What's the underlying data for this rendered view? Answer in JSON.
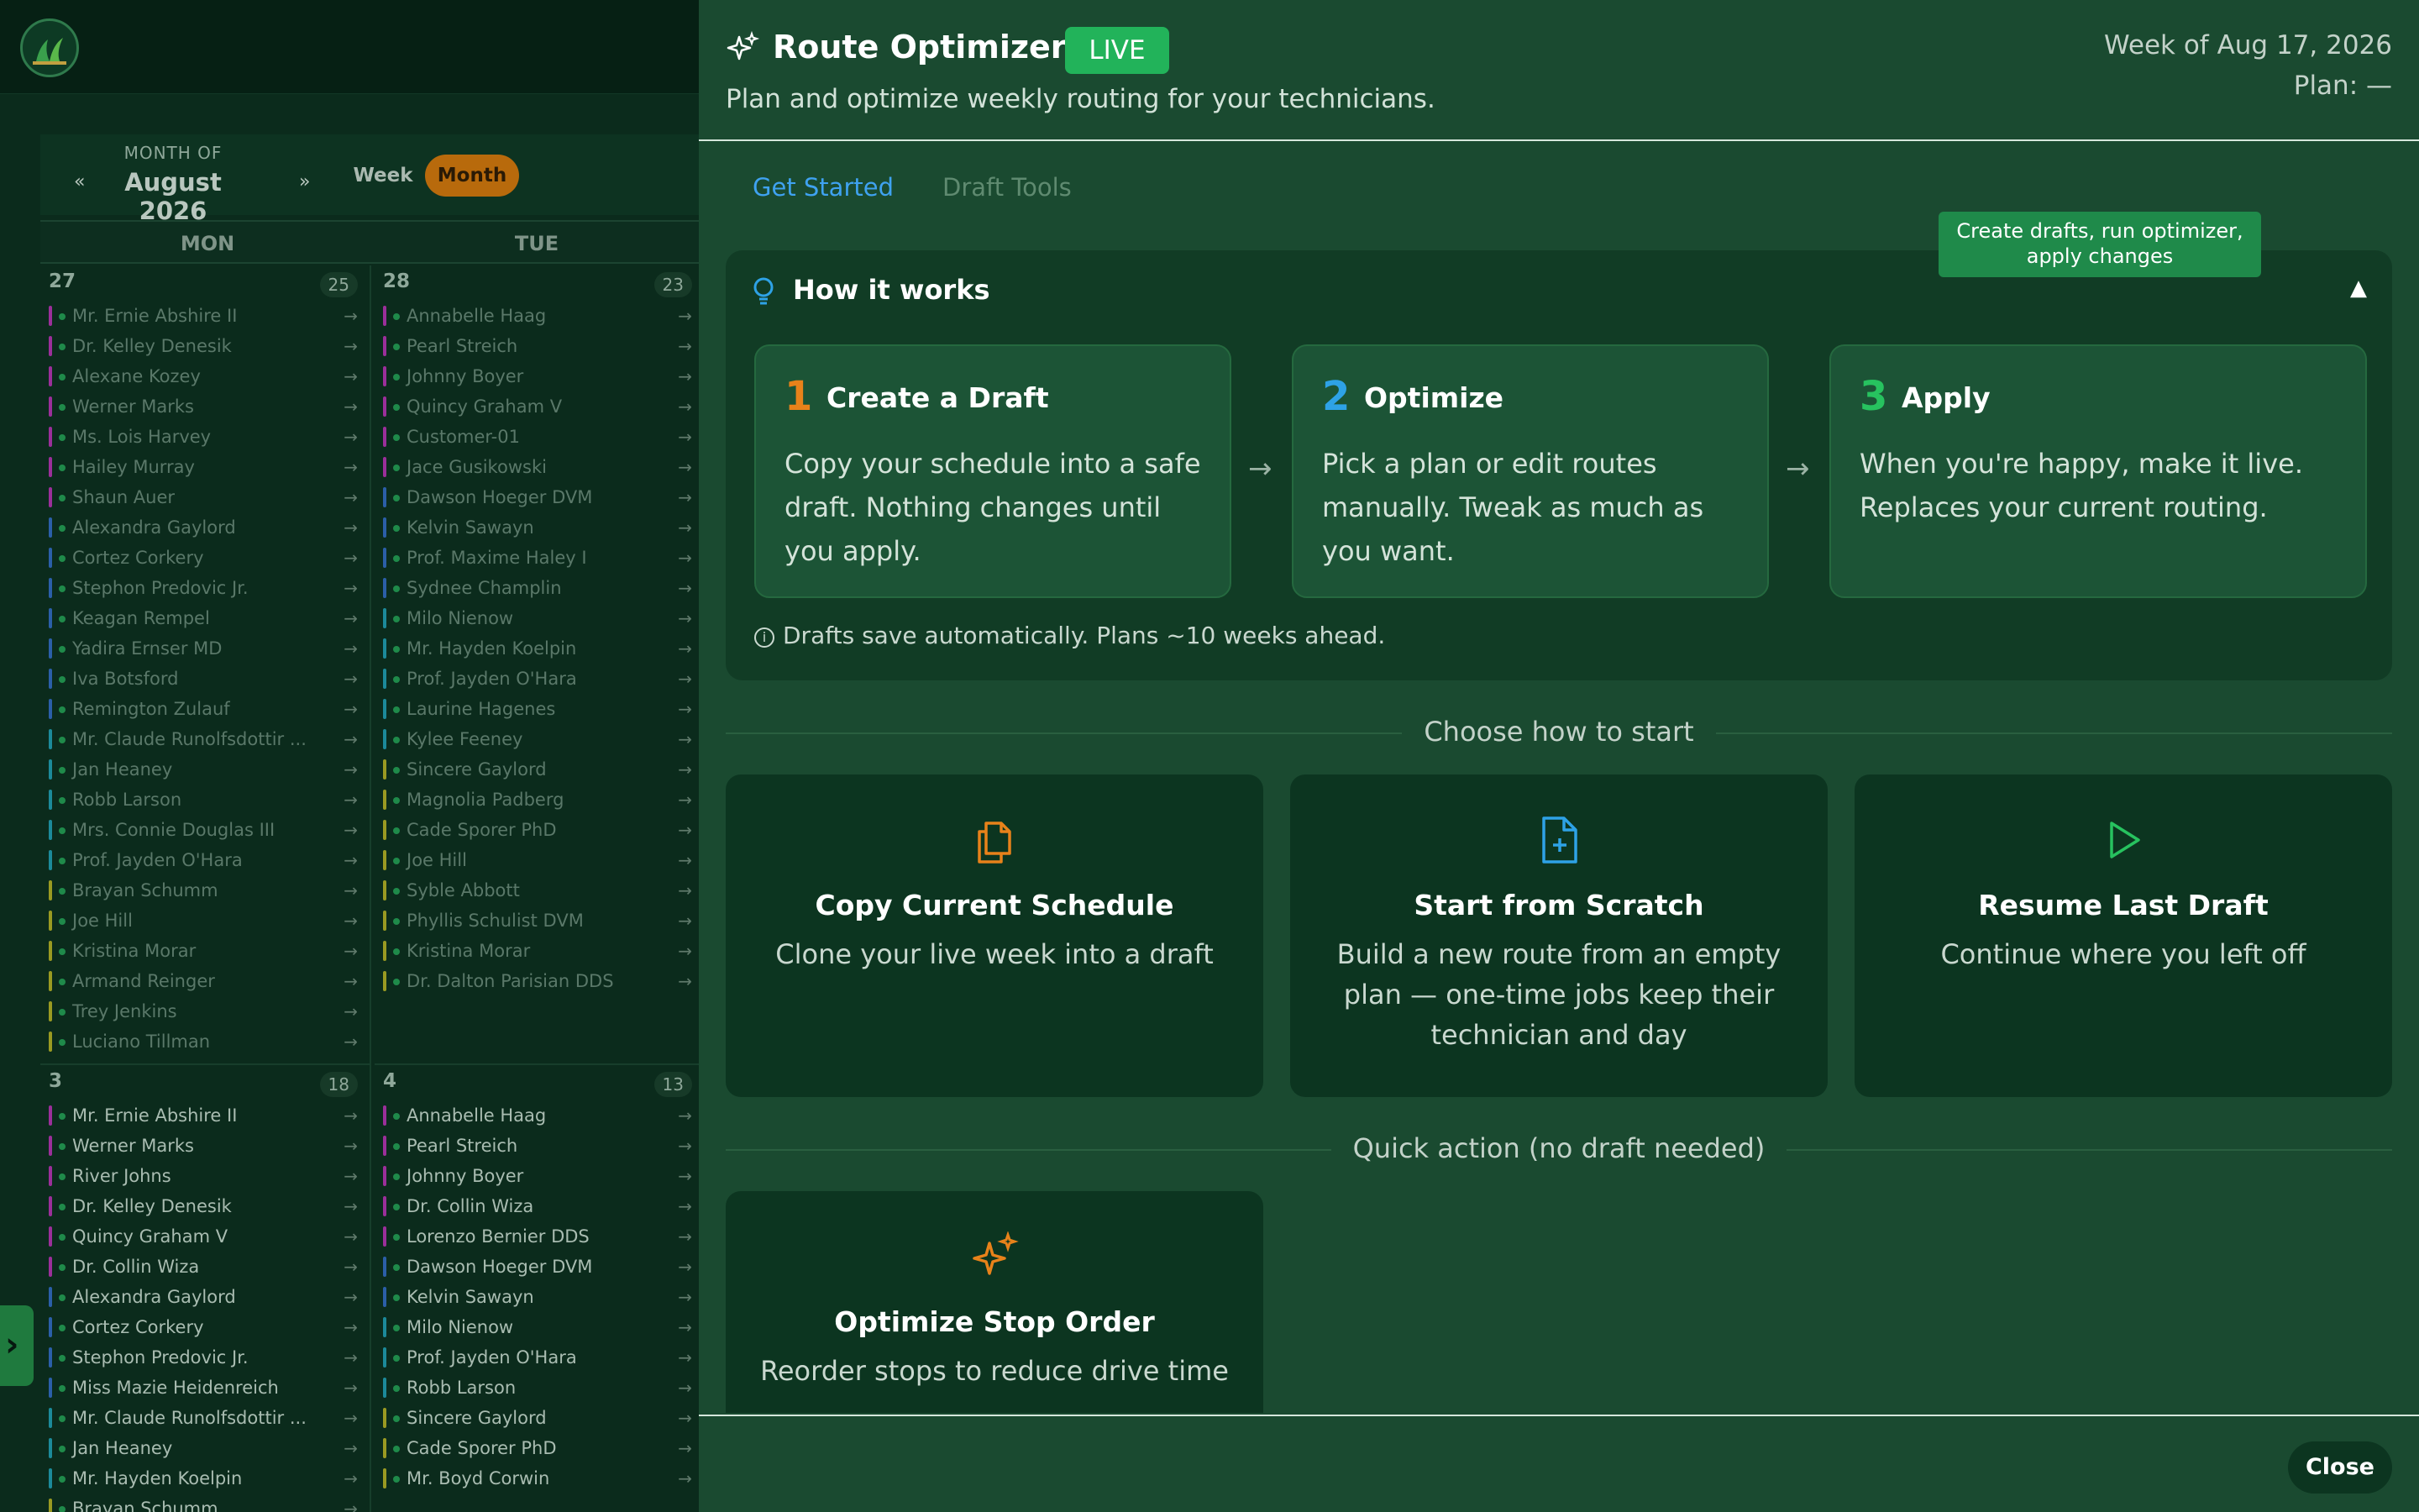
{
  "calendar": {
    "month_of_label": "MONTH OF",
    "month_name": "August 2026",
    "prev_symbol": "«",
    "next_symbol": "»",
    "view_week": "Week",
    "view_month": "Month",
    "days_of_week": [
      "MON",
      "TUE"
    ],
    "arrow": "→",
    "cells": [
      {
        "num": "27",
        "count": "25",
        "appointments": [
          {
            "name": "Mr. Ernie Abshire II",
            "color": "#9b2f9a"
          },
          {
            "name": "Dr. Kelley Denesik",
            "color": "#9b2f9a"
          },
          {
            "name": "Alexane Kozey",
            "color": "#9b2f9a"
          },
          {
            "name": "Werner Marks",
            "color": "#9b2f9a"
          },
          {
            "name": "Ms. Lois Harvey",
            "color": "#9b2f9a"
          },
          {
            "name": "Hailey Murray",
            "color": "#9b2f9a"
          },
          {
            "name": "Shaun Auer",
            "color": "#9b2f9a"
          },
          {
            "name": "Alexandra Gaylord",
            "color": "#2b5fa8"
          },
          {
            "name": "Cortez Corkery",
            "color": "#2b5fa8"
          },
          {
            "name": "Stephon Predovic Jr.",
            "color": "#2b5fa8"
          },
          {
            "name": "Keagan Rempel",
            "color": "#2b5fa8"
          },
          {
            "name": "Yadira Ernser MD",
            "color": "#2b5fa8"
          },
          {
            "name": "Iva Botsford",
            "color": "#2b5fa8"
          },
          {
            "name": "Remington Zulauf",
            "color": "#2b5fa8"
          },
          {
            "name": "Mr. Claude Runolfsdottir ...",
            "color": "#1c8a9a"
          },
          {
            "name": "Jan Heaney",
            "color": "#1c8a9a"
          },
          {
            "name": "Robb Larson",
            "color": "#1c8a9a"
          },
          {
            "name": "Mrs. Connie Douglas III",
            "color": "#1c8a9a"
          },
          {
            "name": "Prof. Jayden O'Hara",
            "color": "#1c8a9a"
          },
          {
            "name": "Brayan Schumm",
            "color": "#9a9a22"
          },
          {
            "name": "Joe Hill",
            "color": "#9a9a22"
          },
          {
            "name": "Kristina Morar",
            "color": "#9a9a22"
          },
          {
            "name": "Armand Reinger",
            "color": "#9a9a22"
          },
          {
            "name": "Trey Jenkins",
            "color": "#9a9a22"
          },
          {
            "name": "Luciano Tillman",
            "color": "#9a9a22"
          }
        ]
      },
      {
        "num": "28",
        "count": "23",
        "appointments": [
          {
            "name": "Annabelle Haag",
            "color": "#9b2f9a"
          },
          {
            "name": "Pearl Streich",
            "color": "#9b2f9a"
          },
          {
            "name": "Johnny Boyer",
            "color": "#9b2f9a"
          },
          {
            "name": "Quincy Graham V",
            "color": "#9b2f9a"
          },
          {
            "name": "Customer-01",
            "color": "#9b2f9a"
          },
          {
            "name": "Jace Gusikowski",
            "color": "#9b2f9a"
          },
          {
            "name": "Dawson Hoeger DVM",
            "color": "#2b5fa8"
          },
          {
            "name": "Kelvin Sawayn",
            "color": "#2b5fa8"
          },
          {
            "name": "Prof. Maxime Haley I",
            "color": "#2b5fa8"
          },
          {
            "name": "Sydnee Champlin",
            "color": "#2b5fa8"
          },
          {
            "name": "Milo Nienow",
            "color": "#1c8a9a"
          },
          {
            "name": "Mr. Hayden Koelpin",
            "color": "#1c8a9a"
          },
          {
            "name": "Prof. Jayden O'Hara",
            "color": "#1c8a9a"
          },
          {
            "name": "Laurine Hagenes",
            "color": "#1c8a9a"
          },
          {
            "name": "Kylee Feeney",
            "color": "#1c8a9a"
          },
          {
            "name": "Sincere Gaylord",
            "color": "#9a9a22"
          },
          {
            "name": "Magnolia Padberg",
            "color": "#9a9a22"
          },
          {
            "name": "Cade Sporer PhD",
            "color": "#9a9a22"
          },
          {
            "name": "Joe Hill",
            "color": "#9a9a22"
          },
          {
            "name": "Syble Abbott",
            "color": "#9a9a22"
          },
          {
            "name": "Phyllis Schulist DVM",
            "color": "#9a9a22"
          },
          {
            "name": "Kristina Morar",
            "color": "#9a9a22"
          },
          {
            "name": "Dr. Dalton Parisian DDS",
            "color": "#9a9a22"
          }
        ]
      },
      {
        "num": "3",
        "count": "18",
        "appointments": [
          {
            "name": "Mr. Ernie Abshire II",
            "color": "#9b2f9a"
          },
          {
            "name": "Werner Marks",
            "color": "#9b2f9a"
          },
          {
            "name": "River Johns",
            "color": "#9b2f9a"
          },
          {
            "name": "Dr. Kelley Denesik",
            "color": "#9b2f9a"
          },
          {
            "name": "Quincy Graham V",
            "color": "#9b2f9a"
          },
          {
            "name": "Dr. Collin Wiza",
            "color": "#9b2f9a"
          },
          {
            "name": "Alexandra Gaylord",
            "color": "#2b5fa8"
          },
          {
            "name": "Cortez Corkery",
            "color": "#2b5fa8"
          },
          {
            "name": "Stephon Predovic Jr.",
            "color": "#2b5fa8"
          },
          {
            "name": "Miss Mazie Heidenreich",
            "color": "#2b5fa8"
          },
          {
            "name": "Mr. Claude Runolfsdottir ...",
            "color": "#1c8a9a"
          },
          {
            "name": "Jan Heaney",
            "color": "#1c8a9a"
          },
          {
            "name": "Mr. Hayden Koelpin",
            "color": "#1c8a9a"
          },
          {
            "name": "Brayan Schumm",
            "color": "#9a9a22"
          }
        ]
      },
      {
        "num": "4",
        "count": "13",
        "appointments": [
          {
            "name": "Annabelle Haag",
            "color": "#9b2f9a"
          },
          {
            "name": "Pearl Streich",
            "color": "#9b2f9a"
          },
          {
            "name": "Johnny Boyer",
            "color": "#9b2f9a"
          },
          {
            "name": "Dr. Collin Wiza",
            "color": "#9b2f9a"
          },
          {
            "name": "Lorenzo Bernier DDS",
            "color": "#9b2f9a"
          },
          {
            "name": "Dawson Hoeger DVM",
            "color": "#2b5fa8"
          },
          {
            "name": "Kelvin Sawayn",
            "color": "#2b5fa8"
          },
          {
            "name": "Milo Nienow",
            "color": "#1c8a9a"
          },
          {
            "name": "Prof. Jayden O'Hara",
            "color": "#1c8a9a"
          },
          {
            "name": "Robb Larson",
            "color": "#1c8a9a"
          },
          {
            "name": "Sincere Gaylord",
            "color": "#9a9a22"
          },
          {
            "name": "Cade Sporer PhD",
            "color": "#9a9a22"
          },
          {
            "name": "Mr. Boyd Corwin",
            "color": "#9a9a22"
          }
        ]
      }
    ]
  },
  "drawer": {
    "title": "Route Optimizer",
    "badge": "LIVE",
    "subtitle": "Plan and optimize weekly routing for your technicians.",
    "week_of": "Week of Aug 17, 2026",
    "plan": "Plan: —",
    "tabs": {
      "get_started": "Get Started",
      "draft_tools": "Draft Tools"
    },
    "tooltip": "Create drafts, run optimizer, apply changes",
    "how_it_works": {
      "title": "How it works",
      "collapse_symbol": "▲",
      "steps": [
        {
          "num": "1",
          "title": "Create a Draft",
          "text": "Copy your schedule into a safe draft. Nothing changes until you apply.",
          "color": "#e8821a"
        },
        {
          "num": "2",
          "title": "Optimize",
          "text": "Pick a plan or edit routes manually. Tweak as much as you want.",
          "color": "#2ea2e6"
        },
        {
          "num": "3",
          "title": "Apply",
          "text": "When you're happy, make it live. Replaces your current routing.",
          "color": "#27c25f"
        }
      ],
      "arrow": "→",
      "note": "Drafts save automatically. Plans ~10 weeks ahead."
    },
    "choose_label": "Choose how to start",
    "choices": [
      {
        "title": "Copy Current Schedule",
        "desc": "Clone your live week into a draft",
        "icon": "copy-icon",
        "color": "#e8821a"
      },
      {
        "title": "Start from Scratch",
        "desc": "Build a new route from an empty plan — one-time jobs keep their technician and day",
        "icon": "file-plus-icon",
        "color": "#2ea2e6"
      },
      {
        "title": "Resume Last Draft",
        "desc": "Continue where you left off",
        "icon": "play-icon",
        "color": "#27c25f"
      }
    ],
    "quick_label": "Quick action (no draft needed)",
    "quick_action": {
      "title": "Optimize Stop Order",
      "desc": "Reorder stops to reduce drive time",
      "icon": "sparkles-icon",
      "color": "#e8821a"
    },
    "close_label": "Close"
  }
}
